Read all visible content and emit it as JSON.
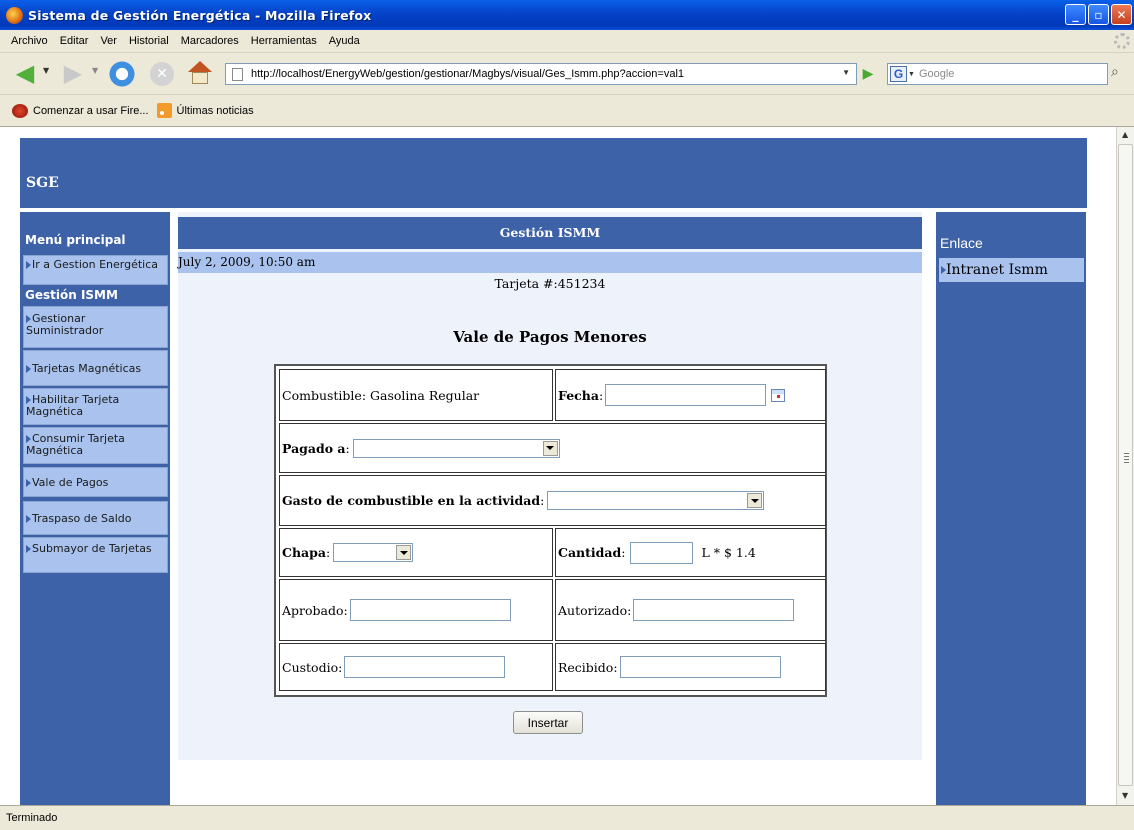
{
  "window": {
    "title": "Sistema de Gestión Energética - Mozilla Firefox",
    "controls": {
      "minimize": "_",
      "maximize": "▫",
      "close": "✕"
    }
  },
  "menubar": [
    "Archivo",
    "Editar",
    "Ver",
    "Historial",
    "Marcadores",
    "Herramientas",
    "Ayuda"
  ],
  "navigation": {
    "url": "http://localhost/EnergyWeb/gestion/gestionar/Magbys/visual/Ges_Ismm.php?accion=val1",
    "search_placeholder": "Google"
  },
  "bookmarks": [
    "Comenzar a usar Fire...",
    "Últimas noticias"
  ],
  "status": "Terminado",
  "page": {
    "brand": "SGE",
    "left_menu": {
      "title": "Menú principal",
      "top_item": "Ir a Gestion Energética",
      "section": "Gestión ISMM",
      "items": [
        "Gestionar Suministrador",
        "Tarjetas Magnéticas",
        "Habilitar Tarjeta Magnética",
        "Consumir Tarjeta Magnética",
        "Vale de Pagos",
        "Traspaso de Saldo",
        "Submayor de Tarjetas"
      ]
    },
    "main": {
      "header": "Gestión ISMM",
      "datetime": "July 2, 2009, 10:50 am",
      "card": "Tarjeta #:451234",
      "form_title": "Vale de Pagos Menores",
      "form": {
        "combustible": "Combustible: Gasolina Regular",
        "fecha_label": "Fecha",
        "fecha_value": "",
        "pagado_label": "Pagado a",
        "pagado_value": "",
        "gasto_label": "Gasto de combustible en la actividad",
        "gasto_value": "",
        "chapa_label": "Chapa",
        "chapa_value": "",
        "cantidad_label": "Cantidad",
        "cantidad_value": "",
        "cantidad_unit": "L * $ 1.4",
        "aprobado_label": "Aprobado:",
        "autorizado_label": "Autorizado:",
        "custodio_label": "Custodio:",
        "recibido_label": "Recibido:",
        "submit": "Insertar"
      }
    },
    "right_menu": {
      "title": "Enlace",
      "items": [
        "Intranet Ismm"
      ]
    }
  },
  "colors": {
    "nav_blue": "#3d62a8",
    "menu_light_blue": "#a9c3ee",
    "main_background": "#eef3fb"
  }
}
